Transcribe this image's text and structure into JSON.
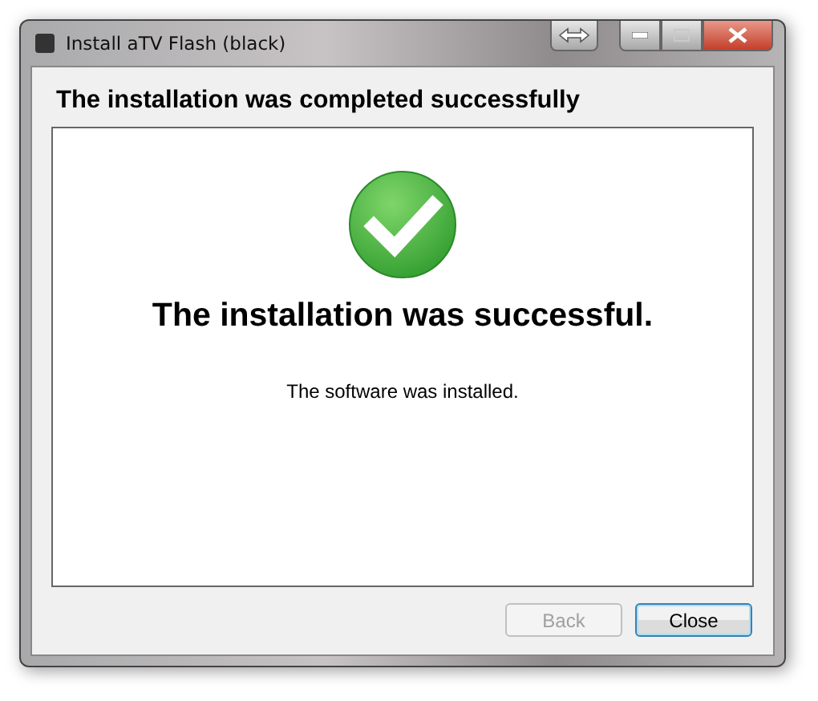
{
  "window": {
    "title": "Install aTV Flash (black)"
  },
  "heading": "The installation was completed successfully",
  "result": {
    "kind": "success",
    "title": "The installation was successful.",
    "message": "The software was installed."
  },
  "buttons": [
    {
      "label": "Back",
      "disabled": true,
      "default": false
    },
    {
      "label": "Close",
      "disabled": false,
      "default": true
    }
  ]
}
